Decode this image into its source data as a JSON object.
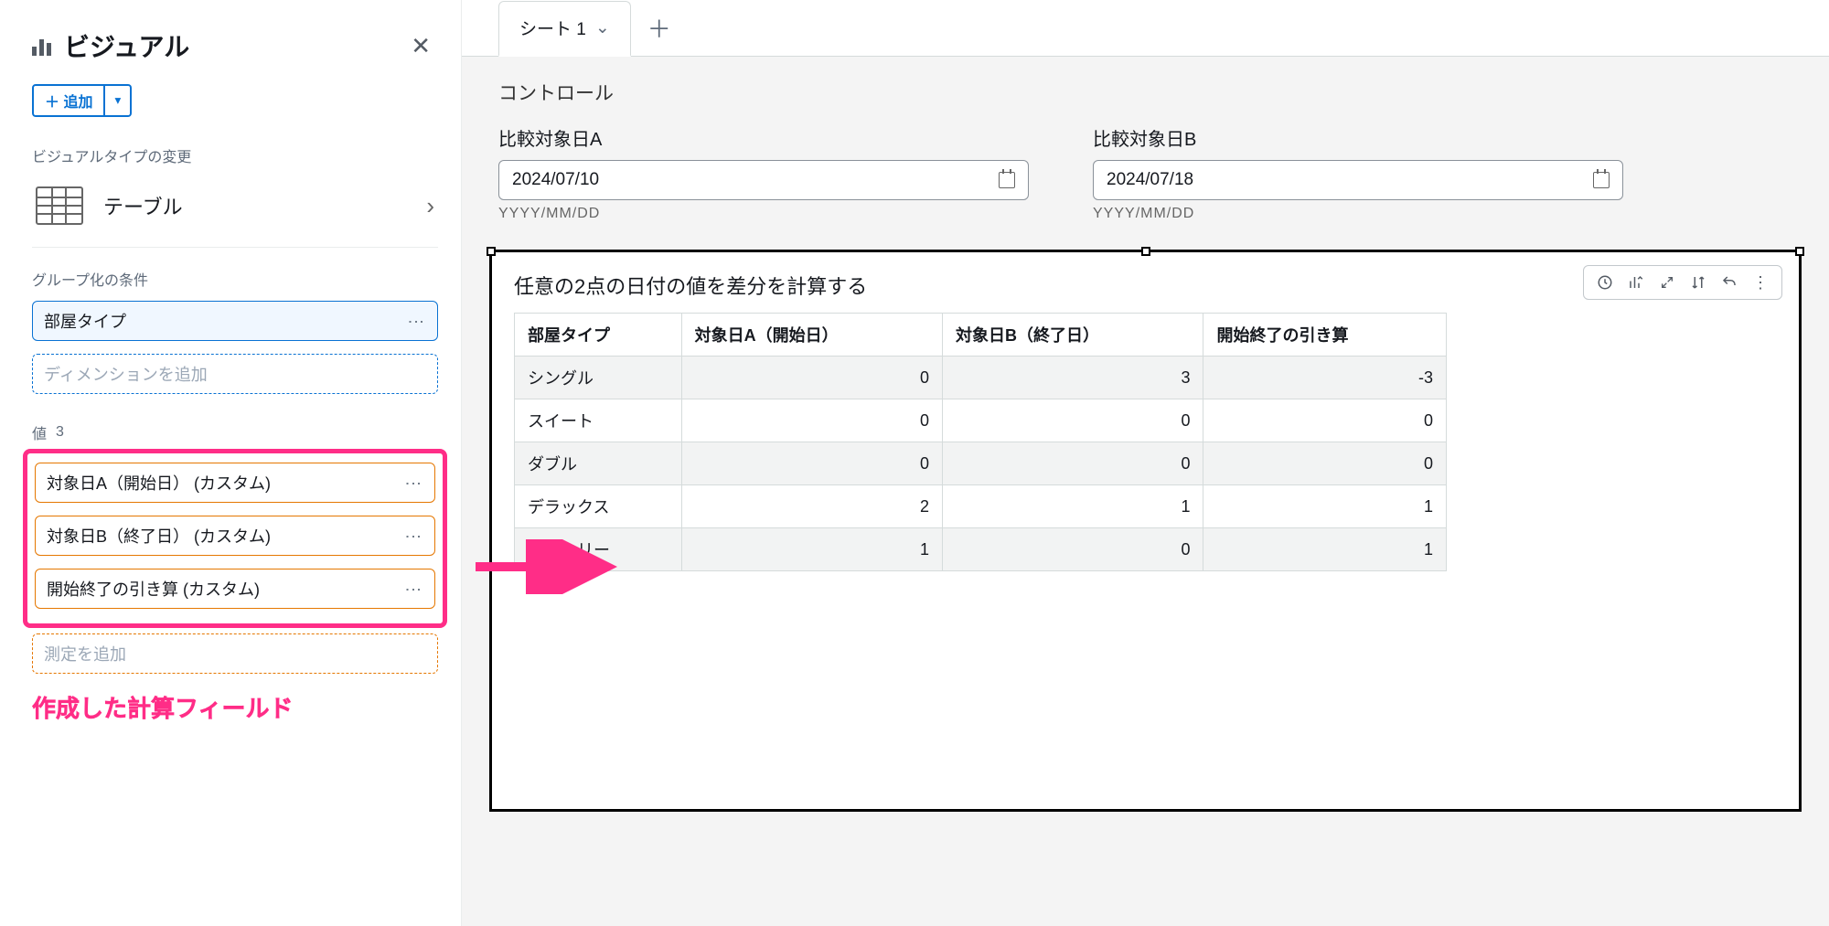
{
  "panel": {
    "title": "ビジュアル",
    "addLabel": "＋ 追加",
    "changeTypeLabel": "ビジュアルタイプの変更",
    "visualTypeName": "テーブル",
    "groupByLabel": "グループ化の条件",
    "groupByField": "部屋タイプ",
    "addDimensionPlaceholder": "ディメンションを追加",
    "valueLabel": "値",
    "valueCount": "3",
    "valueFields": [
      "対象日A（開始日） (カスタム)",
      "対象日B（終了日） (カスタム)",
      "開始終了の引き算 (カスタム)"
    ],
    "addMeasurePlaceholder": "測定を追加",
    "annotation": "作成した計算フィールド"
  },
  "sheet": {
    "tabName": "シート 1",
    "controlsLabel": "コントロール",
    "controls": [
      {
        "label": "比較対象日A",
        "value": "2024/07/10",
        "hint": "YYYY/MM/DD"
      },
      {
        "label": "比較対象日B",
        "value": "2024/07/18",
        "hint": "YYYY/MM/DD"
      }
    ]
  },
  "visual": {
    "title": "任意の2点の日付の値を差分を計算する",
    "columns": [
      "部屋タイプ",
      "対象日A（開始日）",
      "対象日B（終了日）",
      "開始終了の引き算"
    ],
    "rows": [
      {
        "c0": "シングル",
        "c1": "0",
        "c2": "3",
        "c3": "-3"
      },
      {
        "c0": "スイート",
        "c1": "0",
        "c2": "0",
        "c3": "0"
      },
      {
        "c0": "ダブル",
        "c1": "0",
        "c2": "0",
        "c3": "0"
      },
      {
        "c0": "デラックス",
        "c1": "2",
        "c2": "1",
        "c3": "1"
      },
      {
        "c0": "ファミリー",
        "c1": "1",
        "c2": "0",
        "c3": "1"
      }
    ]
  }
}
